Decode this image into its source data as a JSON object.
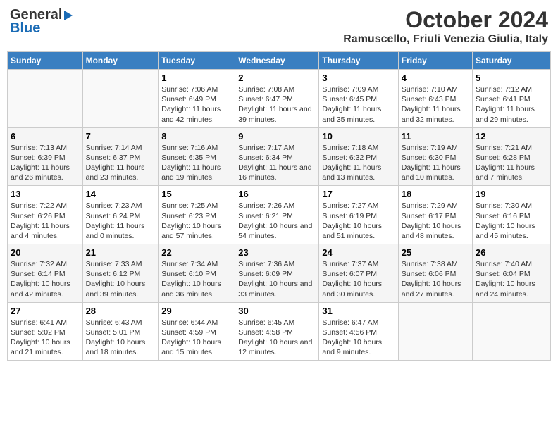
{
  "logo": {
    "line1": "General",
    "line2": "Blue"
  },
  "title": "October 2024",
  "subtitle": "Ramuscello, Friuli Venezia Giulia, Italy",
  "days_of_week": [
    "Sunday",
    "Monday",
    "Tuesday",
    "Wednesday",
    "Thursday",
    "Friday",
    "Saturday"
  ],
  "weeks": [
    [
      {
        "day": "",
        "sunrise": "",
        "sunset": "",
        "daylight": ""
      },
      {
        "day": "",
        "sunrise": "",
        "sunset": "",
        "daylight": ""
      },
      {
        "day": "1",
        "sunrise": "Sunrise: 7:06 AM",
        "sunset": "Sunset: 6:49 PM",
        "daylight": "Daylight: 11 hours and 42 minutes."
      },
      {
        "day": "2",
        "sunrise": "Sunrise: 7:08 AM",
        "sunset": "Sunset: 6:47 PM",
        "daylight": "Daylight: 11 hours and 39 minutes."
      },
      {
        "day": "3",
        "sunrise": "Sunrise: 7:09 AM",
        "sunset": "Sunset: 6:45 PM",
        "daylight": "Daylight: 11 hours and 35 minutes."
      },
      {
        "day": "4",
        "sunrise": "Sunrise: 7:10 AM",
        "sunset": "Sunset: 6:43 PM",
        "daylight": "Daylight: 11 hours and 32 minutes."
      },
      {
        "day": "5",
        "sunrise": "Sunrise: 7:12 AM",
        "sunset": "Sunset: 6:41 PM",
        "daylight": "Daylight: 11 hours and 29 minutes."
      }
    ],
    [
      {
        "day": "6",
        "sunrise": "Sunrise: 7:13 AM",
        "sunset": "Sunset: 6:39 PM",
        "daylight": "Daylight: 11 hours and 26 minutes."
      },
      {
        "day": "7",
        "sunrise": "Sunrise: 7:14 AM",
        "sunset": "Sunset: 6:37 PM",
        "daylight": "Daylight: 11 hours and 23 minutes."
      },
      {
        "day": "8",
        "sunrise": "Sunrise: 7:16 AM",
        "sunset": "Sunset: 6:35 PM",
        "daylight": "Daylight: 11 hours and 19 minutes."
      },
      {
        "day": "9",
        "sunrise": "Sunrise: 7:17 AM",
        "sunset": "Sunset: 6:34 PM",
        "daylight": "Daylight: 11 hours and 16 minutes."
      },
      {
        "day": "10",
        "sunrise": "Sunrise: 7:18 AM",
        "sunset": "Sunset: 6:32 PM",
        "daylight": "Daylight: 11 hours and 13 minutes."
      },
      {
        "day": "11",
        "sunrise": "Sunrise: 7:19 AM",
        "sunset": "Sunset: 6:30 PM",
        "daylight": "Daylight: 11 hours and 10 minutes."
      },
      {
        "day": "12",
        "sunrise": "Sunrise: 7:21 AM",
        "sunset": "Sunset: 6:28 PM",
        "daylight": "Daylight: 11 hours and 7 minutes."
      }
    ],
    [
      {
        "day": "13",
        "sunrise": "Sunrise: 7:22 AM",
        "sunset": "Sunset: 6:26 PM",
        "daylight": "Daylight: 11 hours and 4 minutes."
      },
      {
        "day": "14",
        "sunrise": "Sunrise: 7:23 AM",
        "sunset": "Sunset: 6:24 PM",
        "daylight": "Daylight: 11 hours and 0 minutes."
      },
      {
        "day": "15",
        "sunrise": "Sunrise: 7:25 AM",
        "sunset": "Sunset: 6:23 PM",
        "daylight": "Daylight: 10 hours and 57 minutes."
      },
      {
        "day": "16",
        "sunrise": "Sunrise: 7:26 AM",
        "sunset": "Sunset: 6:21 PM",
        "daylight": "Daylight: 10 hours and 54 minutes."
      },
      {
        "day": "17",
        "sunrise": "Sunrise: 7:27 AM",
        "sunset": "Sunset: 6:19 PM",
        "daylight": "Daylight: 10 hours and 51 minutes."
      },
      {
        "day": "18",
        "sunrise": "Sunrise: 7:29 AM",
        "sunset": "Sunset: 6:17 PM",
        "daylight": "Daylight: 10 hours and 48 minutes."
      },
      {
        "day": "19",
        "sunrise": "Sunrise: 7:30 AM",
        "sunset": "Sunset: 6:16 PM",
        "daylight": "Daylight: 10 hours and 45 minutes."
      }
    ],
    [
      {
        "day": "20",
        "sunrise": "Sunrise: 7:32 AM",
        "sunset": "Sunset: 6:14 PM",
        "daylight": "Daylight: 10 hours and 42 minutes."
      },
      {
        "day": "21",
        "sunrise": "Sunrise: 7:33 AM",
        "sunset": "Sunset: 6:12 PM",
        "daylight": "Daylight: 10 hours and 39 minutes."
      },
      {
        "day": "22",
        "sunrise": "Sunrise: 7:34 AM",
        "sunset": "Sunset: 6:10 PM",
        "daylight": "Daylight: 10 hours and 36 minutes."
      },
      {
        "day": "23",
        "sunrise": "Sunrise: 7:36 AM",
        "sunset": "Sunset: 6:09 PM",
        "daylight": "Daylight: 10 hours and 33 minutes."
      },
      {
        "day": "24",
        "sunrise": "Sunrise: 7:37 AM",
        "sunset": "Sunset: 6:07 PM",
        "daylight": "Daylight: 10 hours and 30 minutes."
      },
      {
        "day": "25",
        "sunrise": "Sunrise: 7:38 AM",
        "sunset": "Sunset: 6:06 PM",
        "daylight": "Daylight: 10 hours and 27 minutes."
      },
      {
        "day": "26",
        "sunrise": "Sunrise: 7:40 AM",
        "sunset": "Sunset: 6:04 PM",
        "daylight": "Daylight: 10 hours and 24 minutes."
      }
    ],
    [
      {
        "day": "27",
        "sunrise": "Sunrise: 6:41 AM",
        "sunset": "Sunset: 5:02 PM",
        "daylight": "Daylight: 10 hours and 21 minutes."
      },
      {
        "day": "28",
        "sunrise": "Sunrise: 6:43 AM",
        "sunset": "Sunset: 5:01 PM",
        "daylight": "Daylight: 10 hours and 18 minutes."
      },
      {
        "day": "29",
        "sunrise": "Sunrise: 6:44 AM",
        "sunset": "Sunset: 4:59 PM",
        "daylight": "Daylight: 10 hours and 15 minutes."
      },
      {
        "day": "30",
        "sunrise": "Sunrise: 6:45 AM",
        "sunset": "Sunset: 4:58 PM",
        "daylight": "Daylight: 10 hours and 12 minutes."
      },
      {
        "day": "31",
        "sunrise": "Sunrise: 6:47 AM",
        "sunset": "Sunset: 4:56 PM",
        "daylight": "Daylight: 10 hours and 9 minutes."
      },
      {
        "day": "",
        "sunrise": "",
        "sunset": "",
        "daylight": ""
      },
      {
        "day": "",
        "sunrise": "",
        "sunset": "",
        "daylight": ""
      }
    ]
  ]
}
